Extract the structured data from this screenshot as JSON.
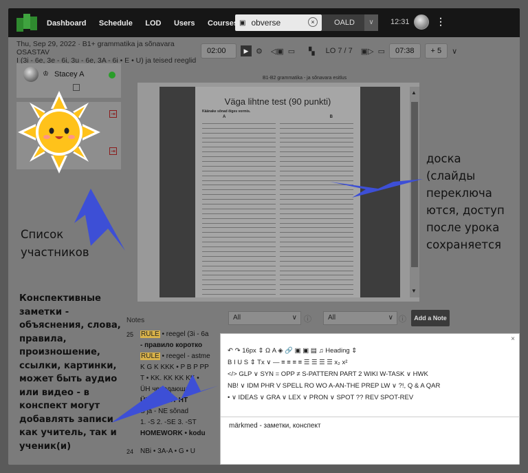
{
  "nav": {
    "items": [
      "Dashboard",
      "Schedule",
      "LOD",
      "Users",
      "Courses"
    ],
    "search_value": "obverse",
    "dictionary": "OALD",
    "clock": "12:31"
  },
  "lesson": {
    "date_line": "Thu, Sep 29, 2022 · B1+ grammatika ja sõnavara OSASTAV",
    "sub_line": "I (3i - 6e, 3e - 6i, 3u - 6e, 3A - 6i • E • U) ja teised reeglid",
    "timer": "02:00",
    "lo_progress": "LO 7 / 7",
    "time_right": "07:38",
    "plus": "+ 5"
  },
  "participants": [
    {
      "name": "Stacey A",
      "online": true
    },
    {
      "name": "",
      "online": false
    },
    {
      "name": "",
      "online": false
    }
  ],
  "board": {
    "header": "B1-B2 grammatika - ja sõnavara esitlus",
    "title": "Väga lihtne test (90 punkti)",
    "instruction": "Käänake sõnad õiges vormis.",
    "col_a": "A",
    "col_b": "B"
  },
  "notes": {
    "label": "Notes",
    "filter_all": "All",
    "filter_all_2": "All",
    "add_button": "Add a Note",
    "entries": [
      {
        "num": "25",
        "lines": [
          "RULE • reegel (3i - 6a",
          "- правило коротко",
          "RULE • reegel - astme",
          "K G K KKK • P B P PP",
          "T • KK. KK KK KK •",
          "ÜH чередающи",
          "ÜH • HT HT HT",
          "S ja - NE sõnad",
          "1. -S 2. -SE 3. -ST",
          "HOMEWORK • kodu"
        ]
      },
      {
        "num": "24",
        "lines": [
          "NBi • 3A-A • G • U"
        ]
      }
    ]
  },
  "editor": {
    "row1": "↶  ↷      16px    ⇕  Ω       A  ◈      🔗  ▣  ▣  ▤  ♫        Heading   ⇕",
    "row2": "B  I  U  S  ⇕   Tx  ∨  —       ≡  ≡  ≡  ≡      ☰  ☰  ☰  ☰    x₂  x²",
    "row3": "</>   GLP  ∨  SYN =   OPP ≠   S-PATTERN   PART 2   WIKI   W-TASK  ∨  HWK",
    "row4": "NB!  ∨  IDM   PHR V   SPELL   RO   WO   A-AN-THE   PREP   LW  ∨  ?!,   Q & A   QAR",
    "row5": "•  ∨  IDEAS  ∨  GRA  ∨  LEX  ∨  PRON  ∨  SPOT   ??   REV   SPOT-REV",
    "content": "märkmed - заметки, конспект"
  },
  "callouts": {
    "board": [
      "доска",
      "(слайды",
      "переключа",
      "ются, доступ",
      "после урока",
      "сохраняется"
    ],
    "participants": [
      "Список",
      "участников"
    ],
    "notes": [
      "Конспективные",
      "заметки -",
      "объяснения, слова,",
      "правила,",
      "произношение,",
      "ссылки, картинки,",
      "может быть аудио",
      "или видео - в",
      "конспект могут",
      "добавлять записи",
      "как учитель, так и",
      "ученик(и)"
    ]
  },
  "colors": {
    "arrow": "#3d4fd6",
    "sun": "#ffc21a",
    "navbar": "#161616",
    "rule_tag": "#d9b24a"
  }
}
